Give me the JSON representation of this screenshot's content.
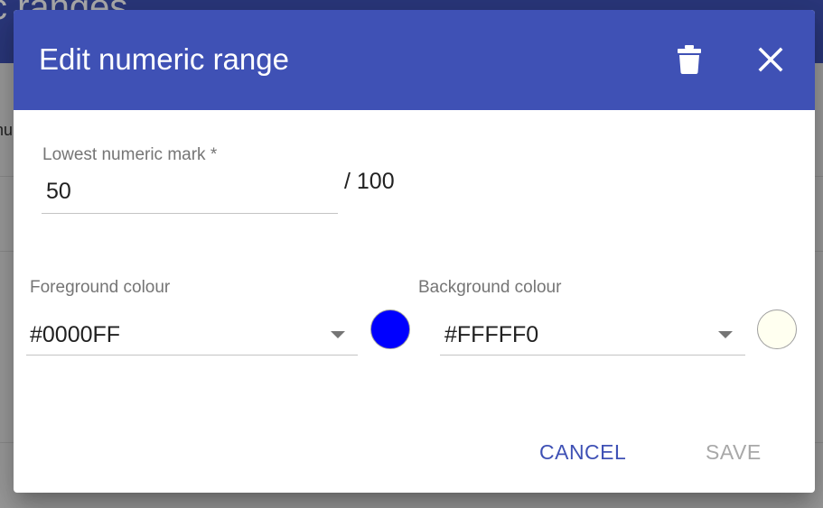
{
  "background": {
    "title": "c ranges",
    "column_label": "nu"
  },
  "dialog": {
    "title": "Edit numeric range",
    "header_color": "#3f51b5",
    "icons": {
      "delete": "trash-icon",
      "close": "close-icon"
    },
    "lowest_mark": {
      "label": "Lowest numeric mark *",
      "value": "50",
      "denominator": "/ 100"
    },
    "foreground": {
      "label": "Foreground colour",
      "value": "#0000FF",
      "swatch_color": "#0000FF"
    },
    "background": {
      "label": "Background colour",
      "value": "#FFFFF0",
      "swatch_color": "#FFFFF0"
    },
    "actions": {
      "cancel": "CANCEL",
      "save": "SAVE"
    }
  }
}
